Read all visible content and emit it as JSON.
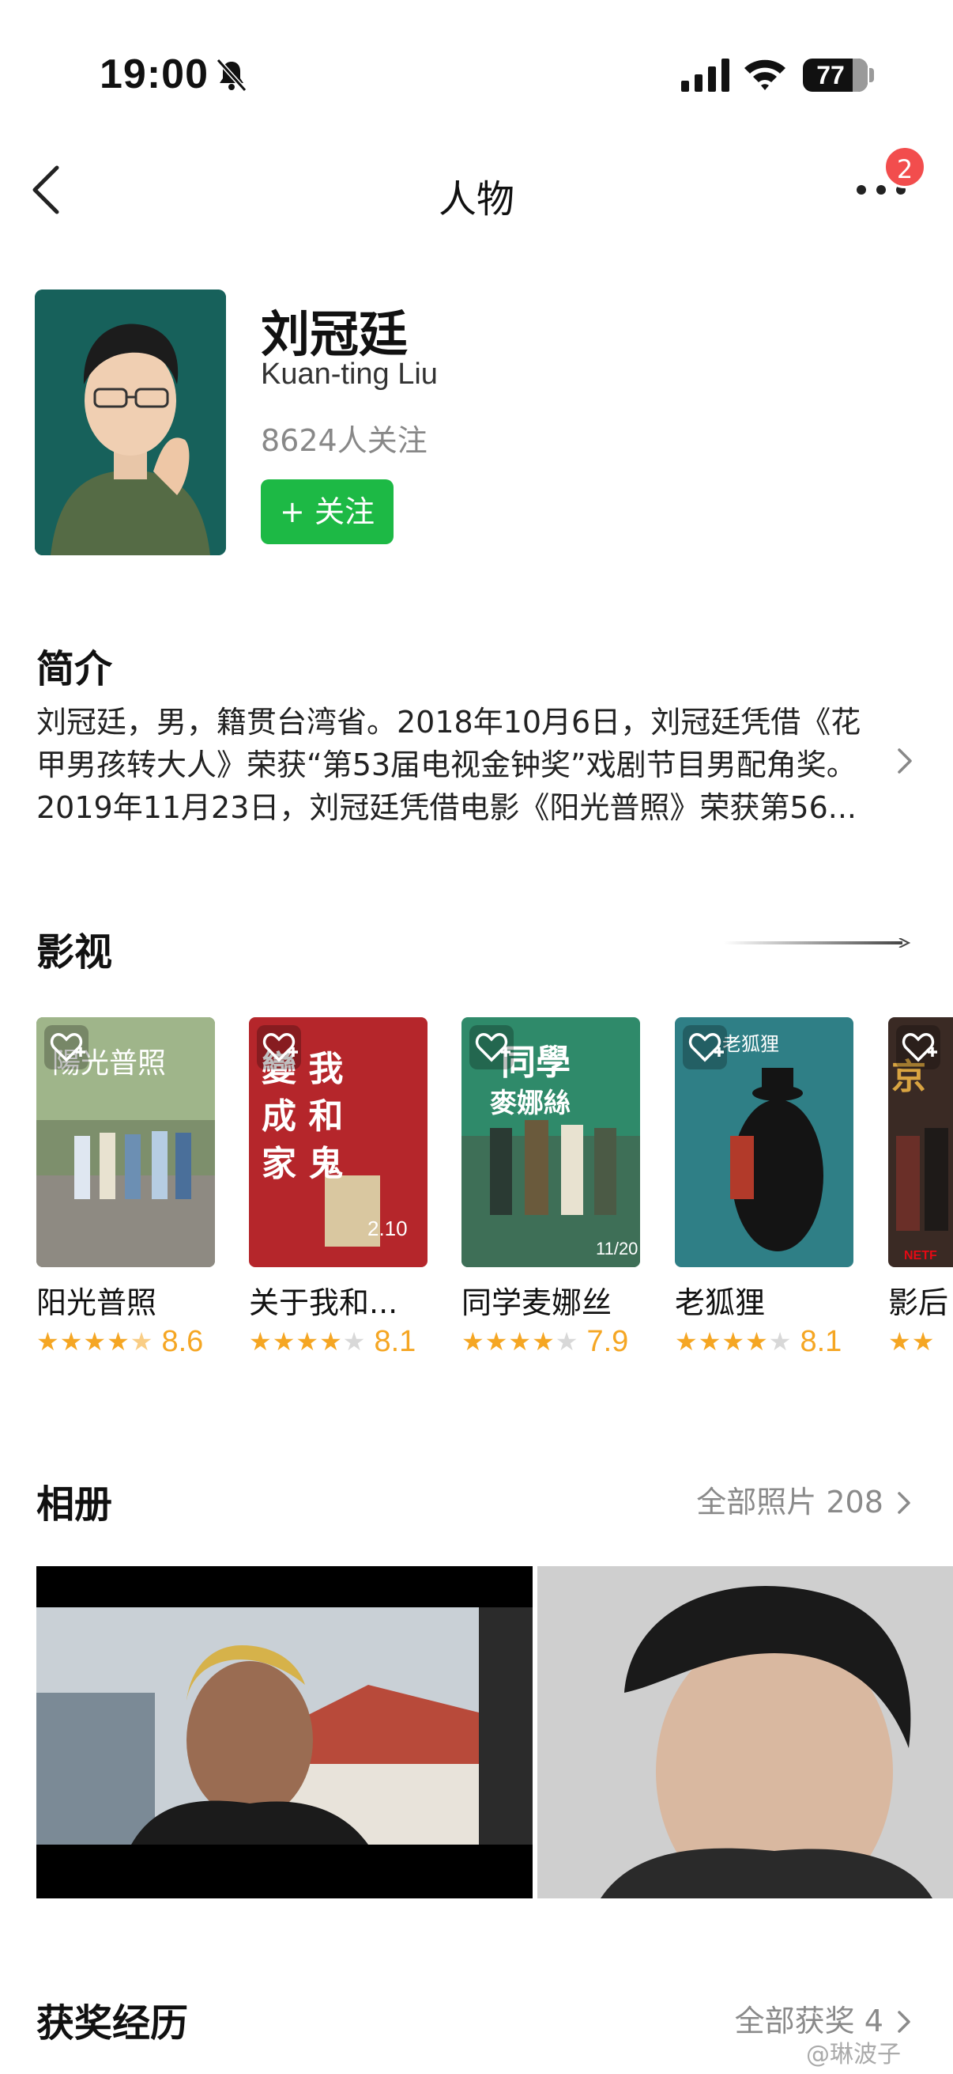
{
  "status_bar": {
    "time": "19:00",
    "battery_percent": "77",
    "battery_level": 0.77
  },
  "nav": {
    "title": "人物",
    "badge_count": "2"
  },
  "person": {
    "name_cn": "刘冠廷",
    "name_en": "Kuan-ting Liu",
    "followers": "8624人关注",
    "follow_label": "+ 关注"
  },
  "intro": {
    "title": "简介",
    "text": "刘冠廷，男，籍贯台湾省。2018年10月6日，刘冠廷凭借《花甲男孩转大人》荣获“第53届电视金钟奖”戏剧节目男配角奖。2019年11月23日，刘冠廷凭借电影《阳光普照》荣获第56..."
  },
  "films": {
    "title": "影视",
    "items": [
      {
        "title": "阳光普照",
        "stars": "★★★★",
        "half": "★",
        "empty": "",
        "score": "8.6",
        "poster_color": "#6b7f5e",
        "poster_text": "陽光普照"
      },
      {
        "title": "关于我和...",
        "stars": "★★★★",
        "half": "",
        "empty": "★",
        "score": "8.1",
        "poster_color": "#b5262b",
        "poster_text": "關於我和鬼變成家人的那件事"
      },
      {
        "title": "同学麦娜丝",
        "stars": "★★★★",
        "half": "",
        "empty": "★",
        "score": "7.9",
        "poster_color": "#2f8a6a",
        "poster_text": "同學麥娜絲"
      },
      {
        "title": "老狐狸",
        "stars": "★★★★",
        "half": "",
        "empty": "★",
        "score": "8.1",
        "poster_color": "#2f7f86",
        "poster_text": "老狐狸"
      },
      {
        "title": "影后",
        "stars": "★★",
        "half": "",
        "empty": "",
        "score": "",
        "poster_color": "#3a2a24",
        "poster_text": ""
      }
    ]
  },
  "album": {
    "title": "相册",
    "link": "全部照片 208",
    "photo_colors": [
      "#c9d0d6",
      "#cfcfcf"
    ]
  },
  "awards": {
    "title": "获奖经历",
    "link": "全部获奖 4"
  },
  "watermark": "@琳波子",
  "colors": {
    "accent_green": "#1db945",
    "star_orange": "#f5a623",
    "badge_red": "#f24d4d"
  }
}
